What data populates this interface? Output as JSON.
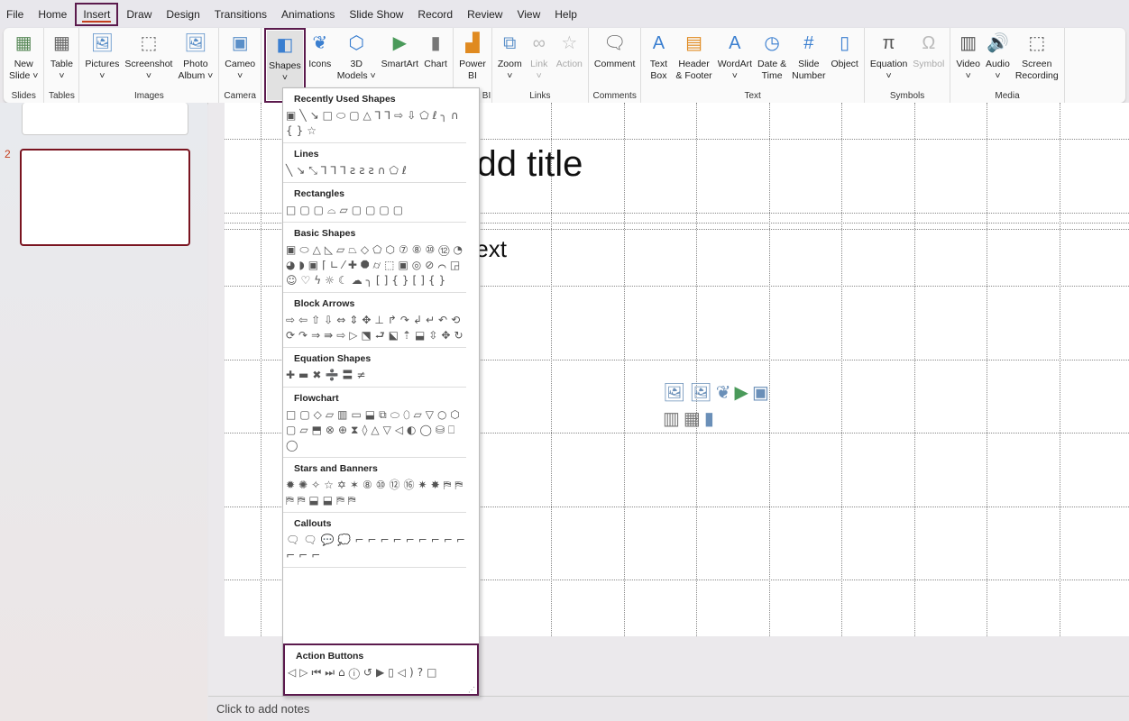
{
  "tabs": [
    "File",
    "Home",
    "Insert",
    "Draw",
    "Design",
    "Transitions",
    "Animations",
    "Slide Show",
    "Record",
    "Review",
    "View",
    "Help"
  ],
  "active_tab": "Insert",
  "ribbon": [
    {
      "label": "Slides",
      "buttons": [
        {
          "name": "new-slide",
          "l1": "New",
          "l2": "Slide ˅",
          "icon": "▦",
          "color": "#5a8a5a"
        }
      ]
    },
    {
      "label": "Tables",
      "buttons": [
        {
          "name": "table",
          "l1": "Table",
          "l2": "˅",
          "icon": "▦",
          "color": "#666"
        }
      ]
    },
    {
      "label": "Images",
      "buttons": [
        {
          "name": "pictures",
          "l1": "Pictures",
          "l2": "˅",
          "icon": "🖼",
          "color": "#5a8fc8"
        },
        {
          "name": "screenshot",
          "l1": "Screenshot",
          "l2": "˅",
          "icon": "⬚",
          "color": "#666"
        },
        {
          "name": "photo-album",
          "l1": "Photo",
          "l2": "Album ˅",
          "icon": "🖼",
          "color": "#5a8fc8"
        }
      ]
    },
    {
      "label": "Camera",
      "buttons": [
        {
          "name": "cameo",
          "l1": "Cameo",
          "l2": "˅",
          "icon": "▣",
          "color": "#5a8fc8"
        }
      ]
    },
    {
      "label": "",
      "buttons": [
        {
          "name": "shapes",
          "l1": "Shapes",
          "l2": "˅",
          "icon": "◧",
          "color": "#3b7fd0",
          "selected": true
        },
        {
          "name": "icons",
          "l1": "Icons",
          "l2": "",
          "icon": "❦",
          "color": "#3b7fd0"
        },
        {
          "name": "3d-models",
          "l1": "3D",
          "l2": "Models ˅",
          "icon": "⬡",
          "color": "#3b7fd0"
        },
        {
          "name": "smartart",
          "l1": "SmartArt",
          "l2": "",
          "icon": "▶",
          "color": "#4a9a5a"
        },
        {
          "name": "chart",
          "l1": "Chart",
          "l2": "",
          "icon": "▮",
          "color": "#777"
        }
      ]
    },
    {
      "label": "Power BI",
      "buttons": [
        {
          "name": "power-bi",
          "l1": "Power",
          "l2": "BI",
          "icon": "▟",
          "color": "#e08a20"
        }
      ]
    },
    {
      "label": "Links",
      "buttons": [
        {
          "name": "zoom",
          "l1": "Zoom",
          "l2": "˅",
          "icon": "⧉",
          "color": "#5a8fc8"
        },
        {
          "name": "link",
          "l1": "Link",
          "l2": "˅",
          "icon": "∞",
          "color": "#bbb",
          "disabled": true
        },
        {
          "name": "action",
          "l1": "Action",
          "l2": "",
          "icon": "☆",
          "color": "#bbb",
          "disabled": true
        }
      ]
    },
    {
      "label": "Comments",
      "buttons": [
        {
          "name": "comment",
          "l1": "Comment",
          "l2": "",
          "icon": "🗨",
          "color": "#666"
        }
      ]
    },
    {
      "label": "Text",
      "buttons": [
        {
          "name": "text-box",
          "l1": "Text",
          "l2": "Box",
          "icon": "A",
          "color": "#3b7fd0"
        },
        {
          "name": "header-footer",
          "l1": "Header",
          "l2": "& Footer",
          "icon": "▤",
          "color": "#e08a20"
        },
        {
          "name": "wordart",
          "l1": "WordArt",
          "l2": "˅",
          "icon": "A",
          "color": "#3b7fd0"
        },
        {
          "name": "date-time",
          "l1": "Date &",
          "l2": "Time",
          "icon": "◷",
          "color": "#3b7fd0"
        },
        {
          "name": "slide-number",
          "l1": "Slide",
          "l2": "Number",
          "icon": "#",
          "color": "#3b7fd0"
        },
        {
          "name": "object",
          "l1": "Object",
          "l2": "",
          "icon": "▯",
          "color": "#3b7fd0"
        }
      ]
    },
    {
      "label": "Symbols",
      "buttons": [
        {
          "name": "equation",
          "l1": "Equation",
          "l2": "˅",
          "icon": "π",
          "color": "#555"
        },
        {
          "name": "symbol",
          "l1": "Symbol",
          "l2": "",
          "icon": "Ω",
          "color": "#bbb",
          "disabled": true
        }
      ]
    },
    {
      "label": "Media",
      "buttons": [
        {
          "name": "video",
          "l1": "Video",
          "l2": "˅",
          "icon": "▥",
          "color": "#555"
        },
        {
          "name": "audio",
          "l1": "Audio",
          "l2": "˅",
          "icon": "🔊",
          "color": "#555"
        },
        {
          "name": "screen-recording",
          "l1": "Screen",
          "l2": "Recording",
          "icon": "⬚",
          "color": "#555"
        }
      ]
    }
  ],
  "thumbnails": {
    "slide_number": "2",
    "selected_border": "#7a1420"
  },
  "slide": {
    "title_placeholder": "Click to add title",
    "text_placeholder": "Click to add text"
  },
  "notes": {
    "placeholder": "Click to add notes"
  },
  "shapes_panel": {
    "sections": [
      {
        "title": "Recently Used Shapes",
        "shapes": "▣╲↘□⬭▢△⅂⅂⇨⇩⬠ℓ╮∩{}☆"
      },
      {
        "title": "Lines",
        "shapes": "╲↘⤡⅂⅂⅂ꙅꙅꙅ∩⬠ℓ"
      },
      {
        "title": "Rectangles",
        "shapes": "□▢▢⌓▱▢▢▢▢"
      },
      {
        "title": "Basic Shapes",
        "shapes": "▣⬭△◺▱⏢◇⬠⬡⑦⑧⑩⑫◔◕◗▣⌈∟⁄✚⯃⌭⬚▣◎⊘⌒◲☺♡ϟ☼☾☁╮[]{}[]{}"
      },
      {
        "title": "Block Arrows",
        "shapes": "⇨⇦⇧⇩⇔⇕✥⊥↱↷↲↵↶⟲⟳↷⇒⇛⇨▷⬔⮐⬕⇡⬓⇳✥↻"
      },
      {
        "title": "Equation Shapes",
        "shapes": "✚▬✖➗〓≠"
      },
      {
        "title": "Flowchart",
        "shapes": "□▢◇▱▥▭⬓⧉⬭⬯▱▽○⬡▢⏥⬒⊗⊕⧗◊△▽◁◐◯⛁⎕◯"
      },
      {
        "title": "Stars and Banners",
        "shapes": "✹✺✧☆✡✶⑧⑩⑫⑯✷✸⛿⛿⛿⛿⬓⬓⛿⛿"
      },
      {
        "title": "Callouts",
        "shapes": "🗨🗨💬💭⌐⌐⌐⌐⌐⌐⌐⌐⌐⌐⌐⌐"
      }
    ],
    "action_buttons": {
      "title": "Action Buttons",
      "shapes": "◁▷⏮⏭⌂ⓘ↺▶▯◁)?□"
    }
  }
}
